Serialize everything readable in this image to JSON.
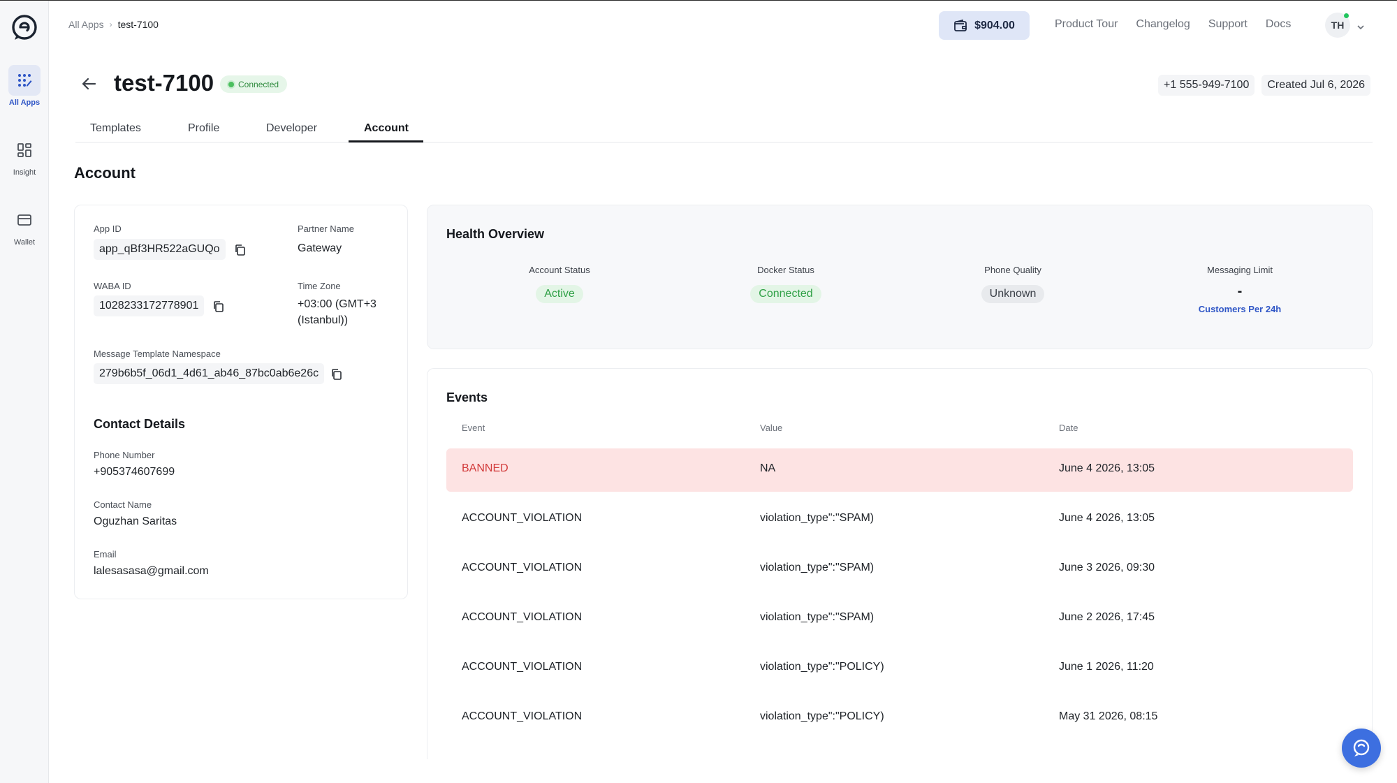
{
  "sidebar": {
    "items": [
      {
        "label": "All Apps",
        "icon": "apps-icon"
      },
      {
        "label": "Insight",
        "icon": "grid-icon"
      },
      {
        "label": "Wallet",
        "icon": "card-icon"
      }
    ]
  },
  "header": {
    "breadcrumb": {
      "root": "All Apps",
      "current": "test-7100"
    },
    "wallet_balance": "$904.00",
    "links": [
      "Product Tour",
      "Changelog",
      "Support",
      "Docs"
    ],
    "avatar_initials": "TH"
  },
  "app": {
    "title": "test-7100",
    "status": "Connected",
    "phone": "+1 555-949-7100",
    "created": "Created Jul 6, 2026"
  },
  "tabs": [
    "Templates",
    "Profile",
    "Developer",
    "Account"
  ],
  "section_title": "Account",
  "account": {
    "app_id_label": "App ID",
    "app_id": "app_qBf3HR522aGUQo",
    "partner_label": "Partner Name",
    "partner": "Gateway",
    "waba_label": "WABA ID",
    "waba": "1028233172778901",
    "tz_label": "Time Zone",
    "tz_line1": "+03:00 (GMT+3",
    "tz_line2": "Istanbul))",
    "ns_label": "Message Template Namespace",
    "ns": "279b6b5f_06d1_4d61_ab46_87bc0ab6e26c"
  },
  "contact": {
    "title": "Contact Details",
    "phone_label": "Phone Number",
    "phone": "+905374607699",
    "name_label": "Contact Name",
    "name": "Oguzhan Saritas",
    "email_label": "Email",
    "email": "lalesasasa@gmail.com"
  },
  "health": {
    "title": "Health Overview",
    "account_status_label": "Account Status",
    "account_status": "Active",
    "docker_label": "Docker Status",
    "docker": "Connected",
    "quality_label": "Phone Quality",
    "quality": "Unknown",
    "limit_label": "Messaging Limit",
    "limit": "-",
    "limit_link": "Customers Per 24h"
  },
  "events": {
    "title": "Events",
    "headers": [
      "Event",
      "Value",
      "Date"
    ],
    "rows": [
      {
        "event": "BANNED",
        "value": "NA",
        "date": "June 4 2026, 13:05"
      },
      {
        "event": "ACCOUNT_VIOLATION",
        "value": "violation_type\":\"SPAM)",
        "date": "June 4 2026, 13:05"
      },
      {
        "event": "ACCOUNT_VIOLATION",
        "value": "violation_type\":\"SPAM)",
        "date": "June 3 2026, 09:30"
      },
      {
        "event": "ACCOUNT_VIOLATION",
        "value": "violation_type\":\"SPAM)",
        "date": "June 2 2026, 17:45"
      },
      {
        "event": "ACCOUNT_VIOLATION",
        "value": "violation_type\":\"POLICY)",
        "date": "June 1 2026, 11:20"
      },
      {
        "event": "ACCOUNT_VIOLATION",
        "value": "violation_type\":\"POLICY)",
        "date": "May 31 2026, 08:15"
      }
    ]
  },
  "colors": {
    "accent": "#2f56c6",
    "success": "#2fa046",
    "danger": "#d23b3b",
    "chat": "#3d6fe0"
  }
}
